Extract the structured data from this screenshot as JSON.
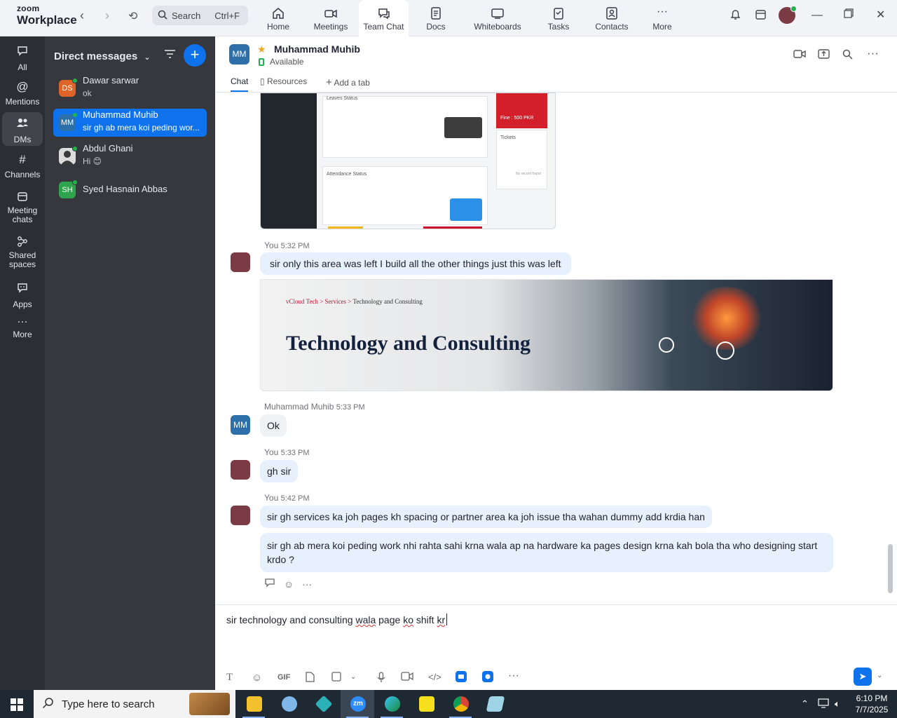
{
  "app": {
    "logo_line1": "zoom",
    "logo_line2": "Workplace",
    "search_label": "Search",
    "search_shortcut": "Ctrl+F"
  },
  "top_tabs": [
    {
      "label": "Home",
      "icon": "home-icon"
    },
    {
      "label": "Meetings",
      "icon": "video-camera-icon"
    },
    {
      "label": "Team Chat",
      "icon": "chat-icon",
      "active": true
    },
    {
      "label": "Docs",
      "icon": "document-icon"
    },
    {
      "label": "Whiteboards",
      "icon": "whiteboard-icon"
    },
    {
      "label": "Tasks",
      "icon": "tasks-icon"
    },
    {
      "label": "Contacts",
      "icon": "contacts-icon"
    },
    {
      "label": "More",
      "icon": "more-icon"
    }
  ],
  "rail": [
    {
      "label": "All",
      "icon": "chat-bubble-icon"
    },
    {
      "label": "Mentions",
      "icon": "at-icon"
    },
    {
      "label": "DMs",
      "icon": "people-icon",
      "active": true
    },
    {
      "label": "Channels",
      "icon": "hash-icon"
    },
    {
      "label": "Meeting chats",
      "icon": "calendar-icon"
    },
    {
      "label": "Shared spaces",
      "icon": "share-icon"
    },
    {
      "label": "Apps",
      "icon": "apps-icon"
    },
    {
      "label": "More",
      "icon": "more-icon"
    }
  ],
  "dm": {
    "header": "Direct messages",
    "items": [
      {
        "initials": "DS",
        "name": "Dawar sarwar",
        "preview": "ok",
        "color": "#e0642a"
      },
      {
        "initials": "MM",
        "name": "Muhammad Muhib",
        "preview": "sir gh ab mera koi peding wor...",
        "color": "#2d6fa8",
        "active": true
      },
      {
        "initials": "",
        "name": "Abdul Ghani",
        "preview": "Hi 😊",
        "color": "#dcdcdc"
      },
      {
        "initials": "SH",
        "name": "Syed Hasnain Abbas",
        "preview": "",
        "color": "#2fa44f"
      }
    ]
  },
  "chat": {
    "contact_initials": "MM",
    "contact_name": "Muhammad Muhib",
    "status": "Available",
    "tabs": [
      "Chat",
      "Resources",
      "Add a tab"
    ]
  },
  "screenshot_preview": {
    "leaves_status": "Leaves Status",
    "attendance_status": "Attendance Status",
    "tickets": "Tickets",
    "fine": "Fine : 500 PKR",
    "no_record": "No record found"
  },
  "messages": {
    "m1": {
      "sender": "You",
      "time": "5:32 PM",
      "text": "sir only this area was left  I build all the other things just this was left"
    },
    "banner": {
      "breadcrumb_home": "vCloud Tech",
      "breadcrumb_sep": ">",
      "breadcrumb_mid": "Services",
      "breadcrumb_end": "Technology and Consulting",
      "title": "Technology and Consulting"
    },
    "m2": {
      "sender": "Muhammad Muhib",
      "time": "5:33 PM",
      "initials": "MM",
      "text": "Ok"
    },
    "m3": {
      "sender": "You",
      "time": "5:33 PM",
      "text": "gh sir"
    },
    "m4": {
      "sender": "You",
      "time": "5:42 PM",
      "text": "sir gh services ka joh pages kh spacing or partner area ka joh issue tha wahan dummy add krdia han"
    },
    "m5": {
      "text": "sir gh ab mera koi peding work nhi rahta sahi krna wala ap na hardware ka pages design krna kah bola tha who designing start krdo ?"
    }
  },
  "compose": {
    "draft_parts": [
      "sir  technology and consulting ",
      "wala",
      " page ",
      "ko",
      " shift ",
      "kr"
    ],
    "format_icons": [
      "text-format-icon",
      "emoji-icon",
      "gif-icon",
      "file-icon",
      "screenshot-icon",
      "microphone-icon",
      "video-clip-icon",
      "code-icon",
      "app-icon",
      "app-icon",
      "more-icon"
    ]
  },
  "taskbar": {
    "search_placeholder": "Type here to search",
    "time": "6:10 PM",
    "date": "7/7/2025"
  }
}
